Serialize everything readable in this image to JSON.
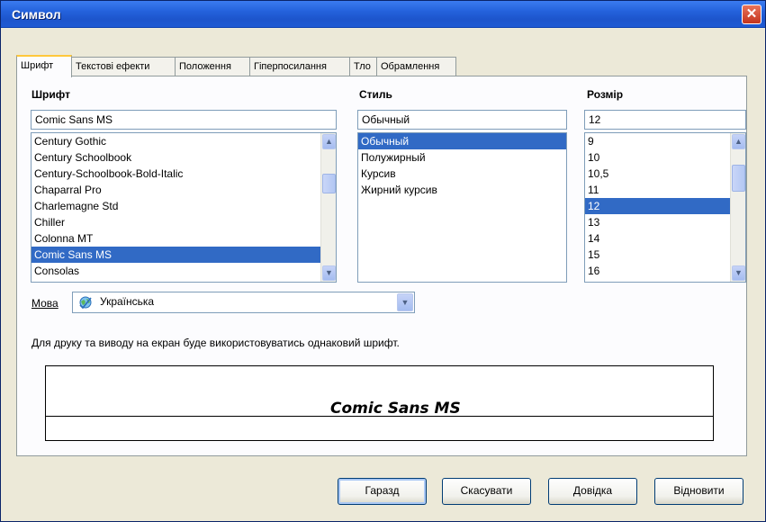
{
  "window": {
    "title": "Символ",
    "close_glyph": "✕"
  },
  "tabs": [
    {
      "label": "Шрифт",
      "active": true
    },
    {
      "label": "Текстові ефекти",
      "active": false
    },
    {
      "label": "Положення",
      "active": false
    },
    {
      "label": "Гіперпосилання",
      "active": false
    },
    {
      "label": "Тло",
      "active": false
    },
    {
      "label": "Обрамлення",
      "active": false
    }
  ],
  "font": {
    "label": "Шрифт",
    "value": "Comic Sans MS",
    "items": [
      "Century Gothic",
      "Century Schoolbook",
      "Century-Schoolbook-Bold-Italic",
      "Chaparral Pro",
      "Charlemagne Std",
      "Chiller",
      "Colonna MT",
      "Comic Sans MS",
      "Consolas"
    ],
    "selected": "Comic Sans MS"
  },
  "style": {
    "label": "Стиль",
    "value": "Обычный",
    "items": [
      "Обычный",
      "Полужирный",
      "Курсив",
      "Жирний курсив"
    ],
    "selected": "Обычный"
  },
  "size": {
    "label": "Розмір",
    "value": "12",
    "items": [
      "9",
      "10",
      "10,5",
      "11",
      "12",
      "13",
      "14",
      "15",
      "16"
    ],
    "selected": "12"
  },
  "language": {
    "label": "Мова",
    "value": "Українська",
    "icon": "spellcheck-globe-icon"
  },
  "info_text": "Для друку та виводу на екран буде використовуватись однаковий шрифт.",
  "preview": {
    "sample_text": "Comic Sans MS"
  },
  "buttons": {
    "ok": "Гаразд",
    "cancel": "Скасувати",
    "help": "Довідка",
    "reset": "Відновити"
  },
  "scroll": {
    "up_glyph": "▲",
    "down_glyph": "▼"
  },
  "colors": {
    "selection": "#316ac5",
    "title_bar": "#2462dc",
    "close_button": "#c4341d",
    "tab_highlight": "#ffc83c"
  }
}
